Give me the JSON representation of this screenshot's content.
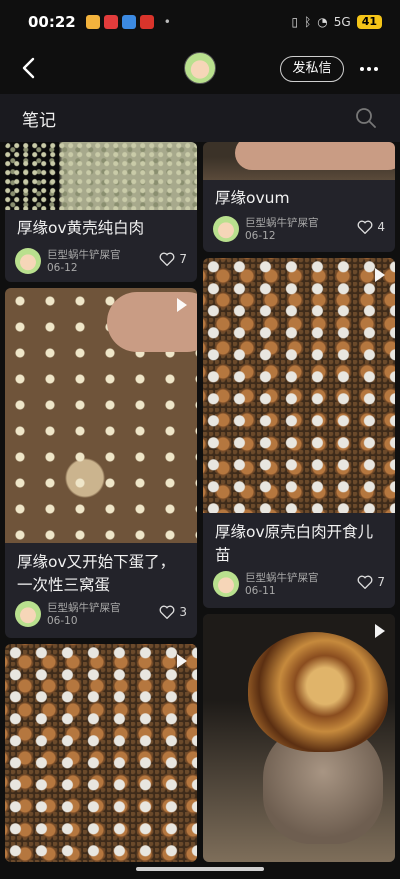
{
  "status_bar": {
    "time": "00:22",
    "battery": "41",
    "signal_label": "5G"
  },
  "header": {
    "message_label": "发私信"
  },
  "section": {
    "title": "笔记"
  },
  "cards": [
    {
      "title": "厚缘ov黄壳纯白肉",
      "author": "巨型蜗牛铲屎官",
      "date": "06-12",
      "likes": "7"
    },
    {
      "title": "厚缘ovum",
      "author": "巨型蜗牛铲屎官",
      "date": "06-12",
      "likes": "4"
    },
    {
      "title": "厚缘ov又开始下蛋了，一次性三窝蛋",
      "author": "巨型蜗牛铲屎官",
      "date": "06-10",
      "likes": "3"
    },
    {
      "title": "厚缘ov原壳白肉开食儿苗",
      "author": "巨型蜗牛铲屎官",
      "date": "06-11",
      "likes": "7"
    }
  ],
  "colors": {
    "background": "#0f0f0f",
    "card": "#23232a",
    "section_bar": "#1a1a1f",
    "battery": "#f5c518"
  },
  "icons": [
    "back-arrow-icon",
    "more-icon",
    "search-icon",
    "heart-icon",
    "play-icon"
  ]
}
